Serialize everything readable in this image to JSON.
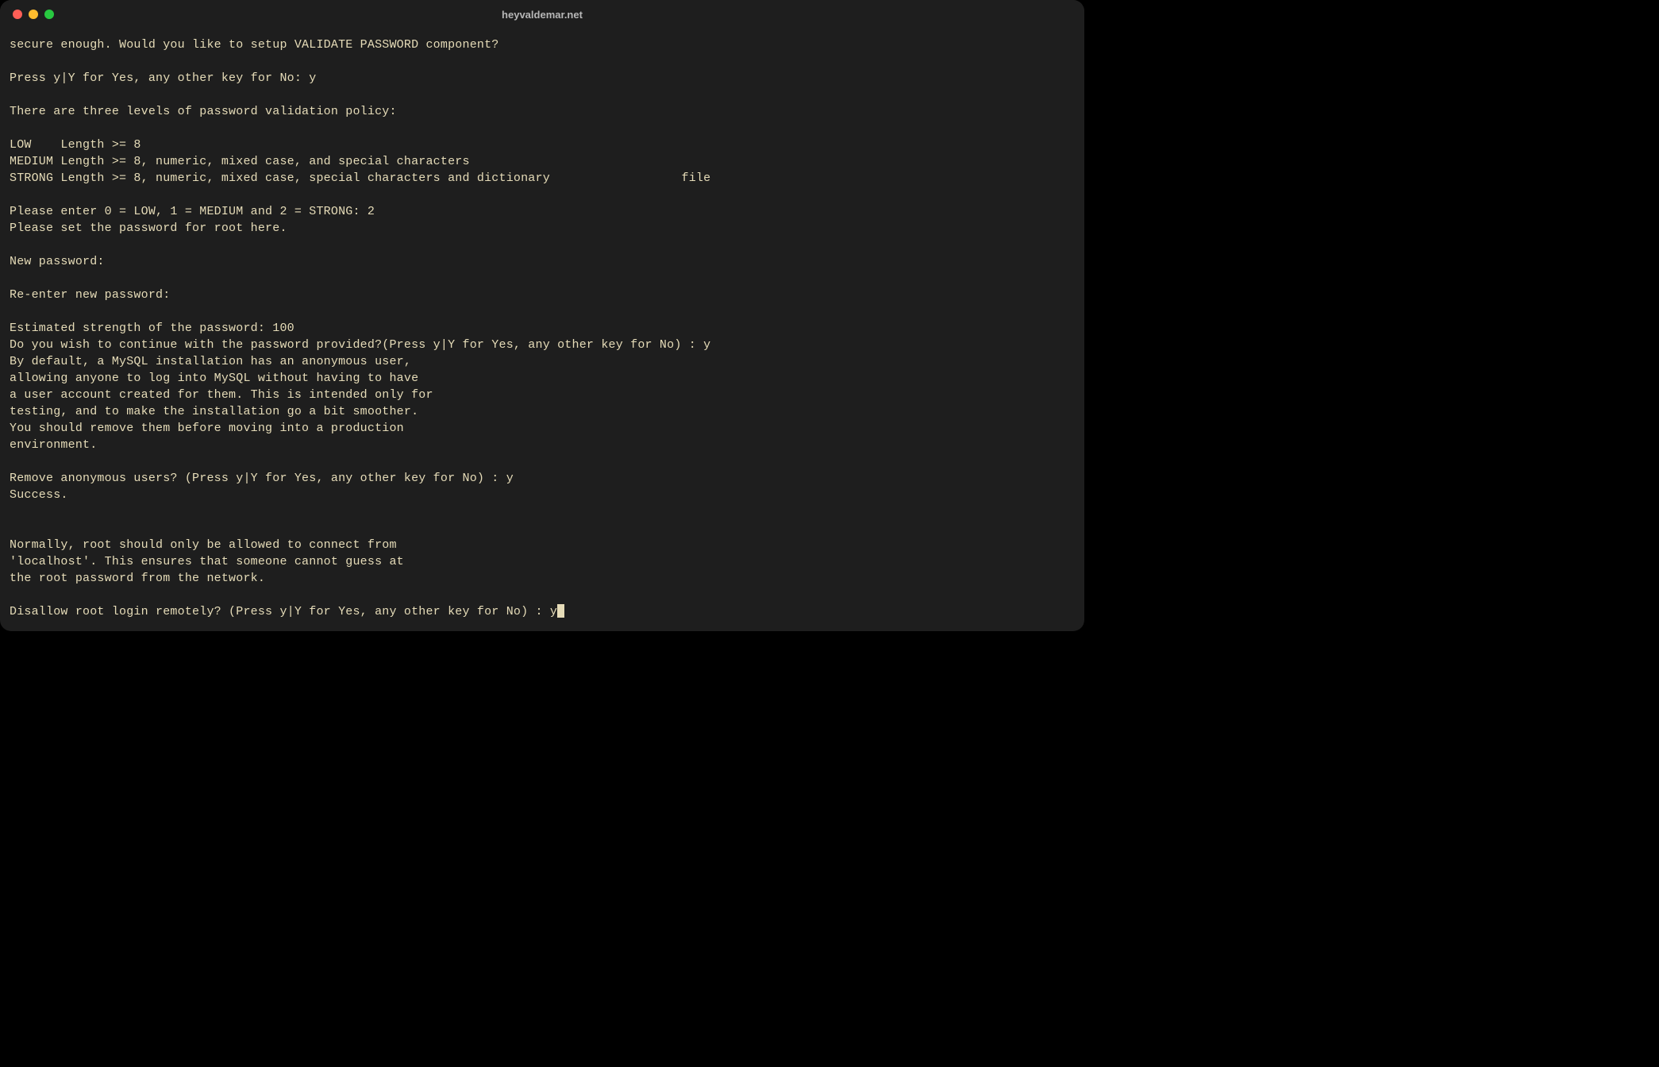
{
  "window": {
    "title": "heyvaldemar.net"
  },
  "colors": {
    "background": "#1e1e1e",
    "text": "#e6dcb8",
    "close": "#ff5f57",
    "minimize": "#febc2e",
    "maximize": "#28c840",
    "title_text": "#b7b7b7"
  },
  "terminal": {
    "lines": [
      "secure enough. Would you like to setup VALIDATE PASSWORD component?",
      "",
      "Press y|Y for Yes, any other key for No: y",
      "",
      "There are three levels of password validation policy:",
      "",
      "LOW    Length >= 8",
      "MEDIUM Length >= 8, numeric, mixed case, and special characters",
      "STRONG Length >= 8, numeric, mixed case, special characters and dictionary                  file",
      "",
      "Please enter 0 = LOW, 1 = MEDIUM and 2 = STRONG: 2",
      "Please set the password for root here.",
      "",
      "New password:",
      "",
      "Re-enter new password:",
      "",
      "Estimated strength of the password: 100",
      "Do you wish to continue with the password provided?(Press y|Y for Yes, any other key for No) : y",
      "By default, a MySQL installation has an anonymous user,",
      "allowing anyone to log into MySQL without having to have",
      "a user account created for them. This is intended only for",
      "testing, and to make the installation go a bit smoother.",
      "You should remove them before moving into a production",
      "environment.",
      "",
      "Remove anonymous users? (Press y|Y for Yes, any other key for No) : y",
      "Success.",
      "",
      "",
      "Normally, root should only be allowed to connect from",
      "'localhost'. This ensures that someone cannot guess at",
      "the root password from the network.",
      ""
    ],
    "current_line": "Disallow root login remotely? (Press y|Y for Yes, any other key for No) : y"
  }
}
